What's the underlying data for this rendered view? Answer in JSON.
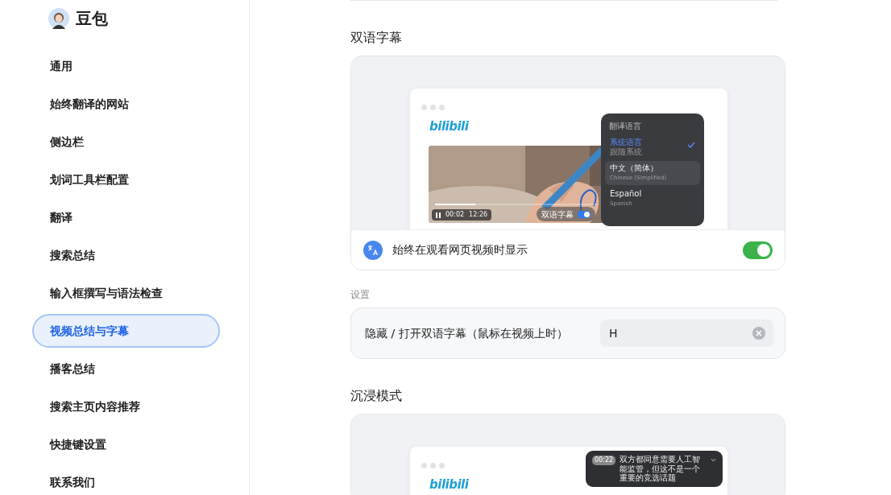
{
  "app": {
    "name": "豆包"
  },
  "sidebar": {
    "items": [
      {
        "label": "通用",
        "selected": false
      },
      {
        "label": "始终翻译的网站",
        "selected": false
      },
      {
        "label": "侧边栏",
        "selected": false
      },
      {
        "label": "划词工具栏配置",
        "selected": false
      },
      {
        "label": "翻译",
        "selected": false
      },
      {
        "label": "搜索总结",
        "selected": false
      },
      {
        "label": "输入框撰写与语法检查",
        "selected": false
      },
      {
        "label": "视频总结与字幕",
        "selected": true
      },
      {
        "label": "播客总结",
        "selected": false
      },
      {
        "label": "搜索主页内容推荐",
        "selected": false
      },
      {
        "label": "快捷键设置",
        "selected": false
      },
      {
        "label": "联系我们",
        "selected": false
      }
    ]
  },
  "bilingual": {
    "title": "双语字幕",
    "preview": {
      "logo": "bilibili",
      "menu_title": "翻译语言",
      "languages": [
        {
          "name": "系统语言",
          "sub": "跟随系统",
          "selected": true,
          "hovered": false
        },
        {
          "name": "中文（简体）",
          "sub": "Chinese (Simplified)",
          "selected": false,
          "hovered": true
        },
        {
          "name": "Español",
          "sub": "Spanish",
          "selected": false,
          "hovered": false
        }
      ],
      "time_current": "00:02",
      "time_total": "12:26",
      "progress": {
        "level": 0.25
      },
      "subtitle_button": {
        "label": "双语字幕",
        "on": true
      }
    },
    "toggle_row": {
      "label": "始终在观看网页视频时显示",
      "on": true
    }
  },
  "settings": {
    "title": "设置",
    "shortcut": {
      "label": "隐藏 / 打开双语字幕（鼠标在视频上时）",
      "value": "H"
    }
  },
  "immersive": {
    "title": "沉浸模式",
    "preview": {
      "logo": "bilibili",
      "caption": {
        "time": "00:22",
        "text": "双方都同意需要人工智能监管，但这不是一个重要的竞选话题"
      }
    }
  }
}
